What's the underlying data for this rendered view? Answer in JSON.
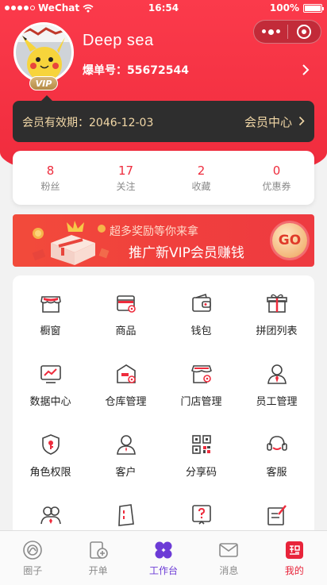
{
  "status_bar": {
    "carrier": "WeChat",
    "time": "16:54",
    "battery": "100%"
  },
  "profile": {
    "username": "Deep sea",
    "order_no": "爆单号：55672544",
    "badge": "VIP"
  },
  "membership": {
    "expiry": "会员有效期：2046-12-03",
    "center_label": "会员中心"
  },
  "stats": [
    {
      "value": "8",
      "label": "粉丝"
    },
    {
      "value": "17",
      "label": "关注"
    },
    {
      "value": "2",
      "label": "收藏"
    },
    {
      "value": "0",
      "label": "优惠券"
    }
  ],
  "banner": {
    "line1": "超多奖励等你来拿",
    "line2": "推广新VIP会员赚钱",
    "go_label": "GO"
  },
  "grid": [
    {
      "label": "橱窗",
      "icon": "storefront-icon"
    },
    {
      "label": "商品",
      "icon": "product-icon"
    },
    {
      "label": "钱包",
      "icon": "wallet-icon"
    },
    {
      "label": "拼团列表",
      "icon": "gift-icon"
    },
    {
      "label": "数据中心",
      "icon": "chart-icon"
    },
    {
      "label": "仓库管理",
      "icon": "warehouse-icon"
    },
    {
      "label": "门店管理",
      "icon": "store-manage-icon"
    },
    {
      "label": "员工管理",
      "icon": "employee-icon"
    },
    {
      "label": "角色权限",
      "icon": "shield-icon"
    },
    {
      "label": "客户",
      "icon": "customer-icon"
    },
    {
      "label": "分享码",
      "icon": "qr-code-icon"
    },
    {
      "label": "客服",
      "icon": "headset-icon"
    },
    {
      "label": "",
      "icon": "users-icon"
    },
    {
      "label": "",
      "icon": "document-icon"
    },
    {
      "label": "",
      "icon": "help-icon"
    },
    {
      "label": "",
      "icon": "edit-icon"
    }
  ],
  "tabs": [
    {
      "label": "圈子",
      "icon": "circle-icon"
    },
    {
      "label": "开单",
      "icon": "new-order-icon"
    },
    {
      "label": "工作台",
      "icon": "workbench-icon"
    },
    {
      "label": "消息",
      "icon": "message-icon"
    },
    {
      "label": "我的",
      "icon": "mine-icon"
    }
  ],
  "colors": {
    "brand_red": "#ef2b3c",
    "gold": "#f2d8a7",
    "purple": "#6c3bd6"
  }
}
